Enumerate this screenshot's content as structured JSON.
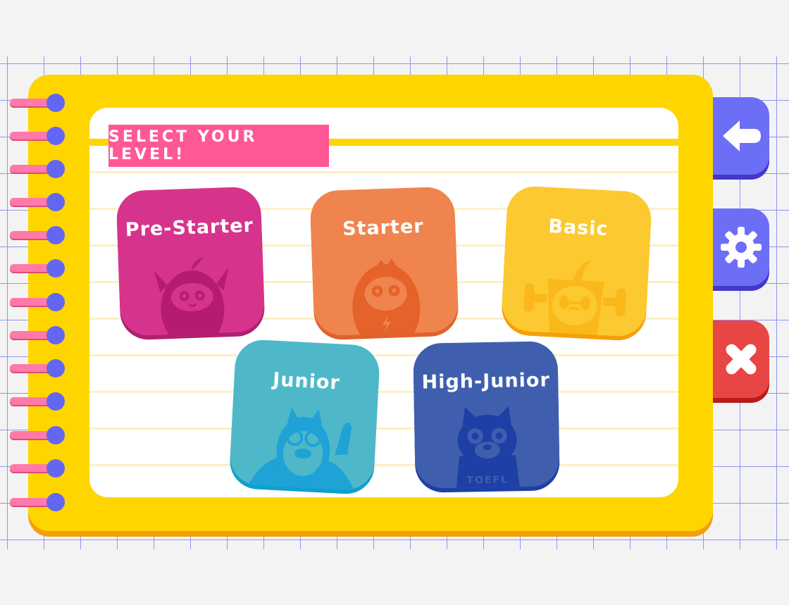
{
  "header": {
    "title": "SELECT YOUR LEVEL!"
  },
  "levels": [
    {
      "label": "Pre-Starter",
      "color": "#d6348c",
      "shadow": "#b01f70"
    },
    {
      "label": "Starter",
      "color": "#f0844e",
      "shadow": "#e0622a"
    },
    {
      "label": "Basic",
      "color": "#fcc930",
      "shadow": "#f59e0b"
    },
    {
      "label": "Junior",
      "color": "#4fb8c8",
      "shadow": "#0ea0cf"
    },
    {
      "label": "High-Junior",
      "color": "#3f5fae",
      "shadow": "#1e3fa6"
    }
  ],
  "side_buttons": [
    {
      "icon": "back-arrow-icon",
      "color": "#6c6ef5"
    },
    {
      "icon": "gear-icon",
      "color": "#6c6ef5"
    },
    {
      "icon": "close-icon",
      "color": "#e84545"
    }
  ],
  "mascot_texts": {
    "high_junior_shirt": "TOEFL"
  }
}
